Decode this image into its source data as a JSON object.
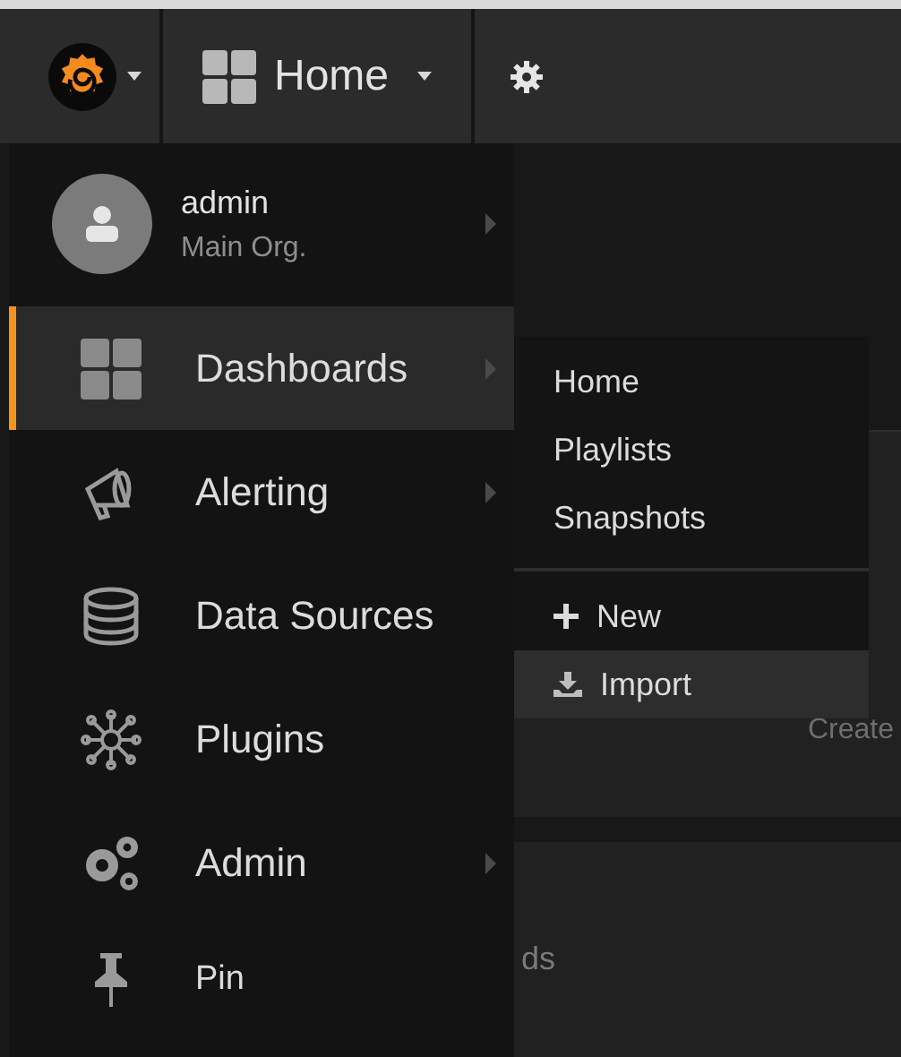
{
  "topbar": {
    "dashboard_title": "Home"
  },
  "user": {
    "name": "admin",
    "org": "Main Org.",
    "has_submenu": true
  },
  "menu": [
    {
      "label": "Dashboards",
      "kind": "dashboards",
      "has_submenu": true,
      "selected": true
    },
    {
      "label": "Alerting",
      "kind": "alerting",
      "has_submenu": true,
      "selected": false
    },
    {
      "label": "Data Sources",
      "kind": "datasources",
      "has_submenu": false,
      "selected": false
    },
    {
      "label": "Plugins",
      "kind": "plugins",
      "has_submenu": false,
      "selected": false
    },
    {
      "label": "Admin",
      "kind": "admin",
      "has_submenu": true,
      "selected": false
    },
    {
      "label": "Pin",
      "kind": "pin",
      "has_submenu": false,
      "selected": false
    }
  ],
  "submenu": [
    {
      "label": "Home",
      "kind": "link",
      "selected": false
    },
    {
      "label": "Playlists",
      "kind": "link",
      "selected": false
    },
    {
      "label": "Snapshots",
      "kind": "link",
      "selected": false
    },
    {
      "label": "New",
      "kind": "new",
      "selected": false
    },
    {
      "label": "Import",
      "kind": "import",
      "selected": true
    }
  ],
  "background": {
    "panel_text": "Create",
    "list_text": "ds"
  }
}
